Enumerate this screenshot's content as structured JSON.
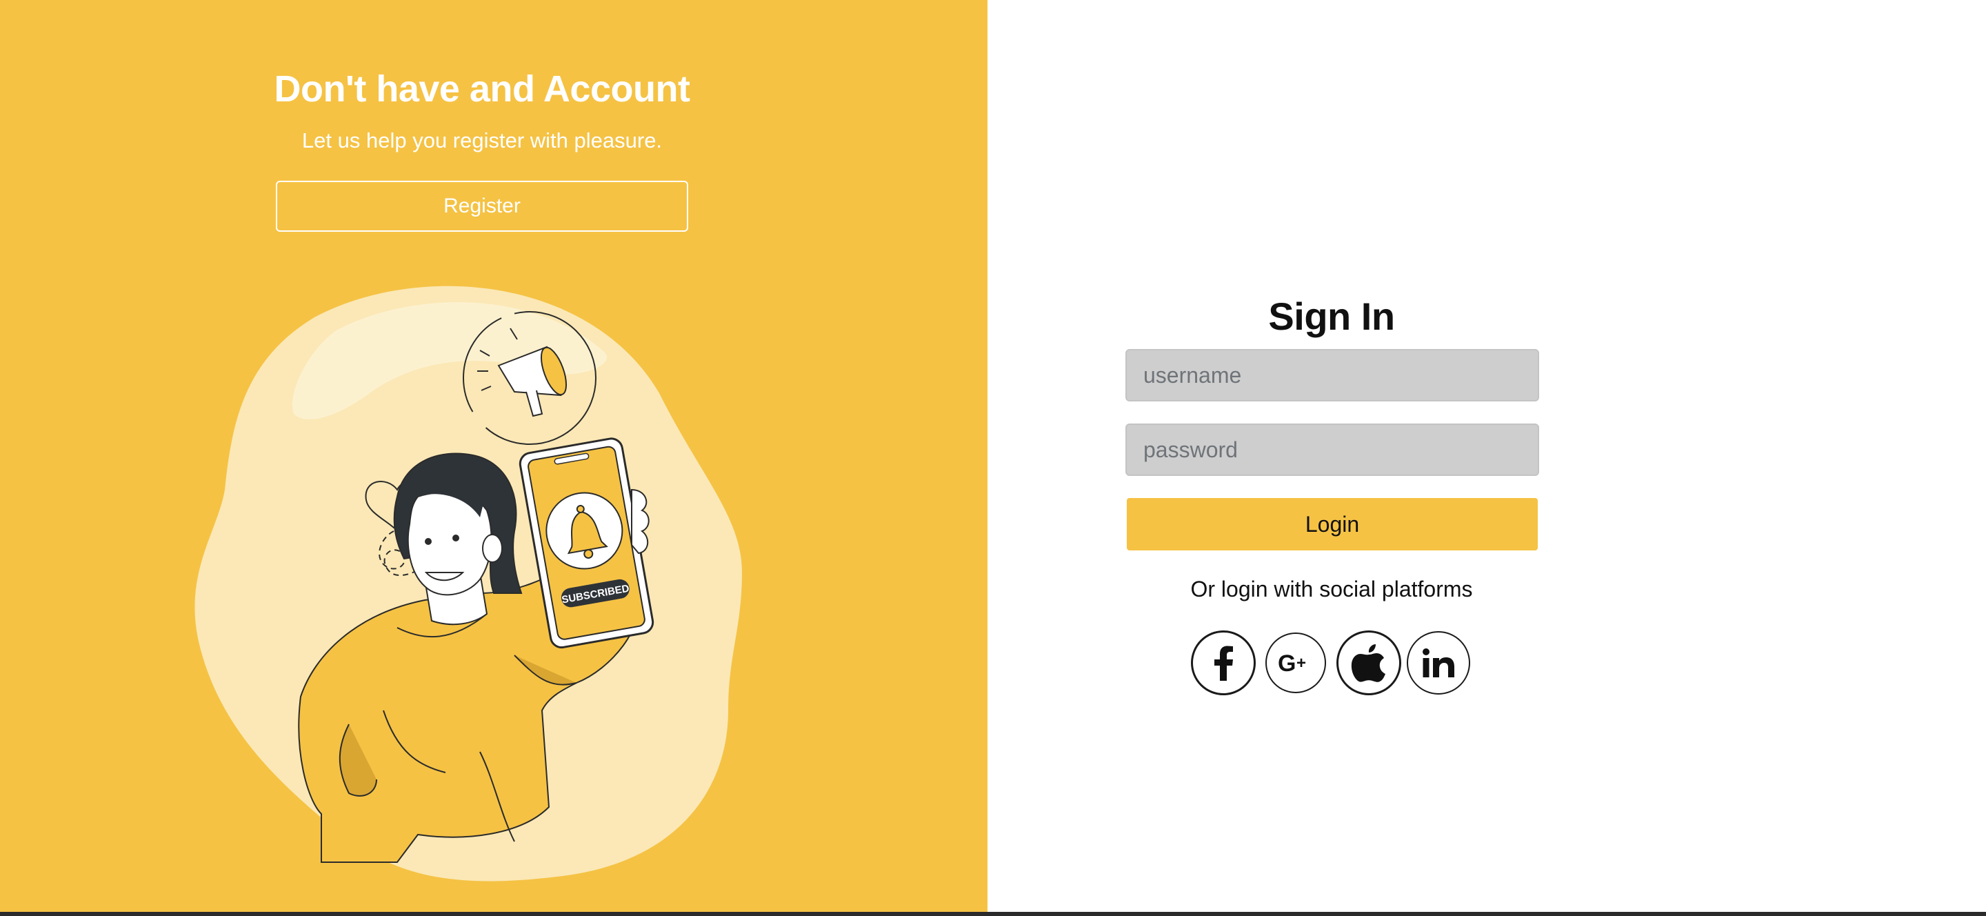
{
  "promo": {
    "title": "Don't have and Account",
    "subtitle": "Let us help you register with pleasure.",
    "register_label": "Register",
    "badge_text": "SUBSCRIBED"
  },
  "signin": {
    "title": "Sign In",
    "username_placeholder": "username",
    "password_placeholder": "password",
    "login_label": "Login",
    "social_text": "Or login with social platforms",
    "social_icons": [
      "facebook-icon",
      "google-plus-icon",
      "apple-icon",
      "linkedin-icon"
    ]
  },
  "colors": {
    "accent": "#f5c244",
    "light_blob": "#fbe8b6",
    "field_bg": "#cecece",
    "outline": "#1a1a1a"
  }
}
